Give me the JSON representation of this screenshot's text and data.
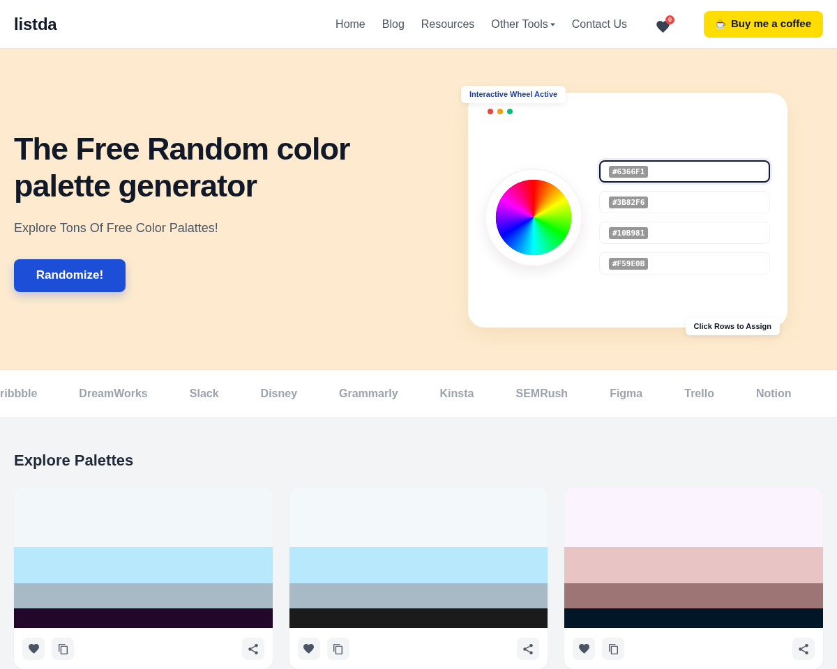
{
  "navbar": {
    "logo": "listda",
    "links": [
      {
        "label": "Home",
        "kind": "link"
      },
      {
        "label": "Blog",
        "kind": "link"
      },
      {
        "label": "Resources",
        "kind": "link"
      },
      {
        "label": "Other Tools",
        "kind": "dropdown"
      },
      {
        "label": "Contact Us",
        "kind": "link"
      }
    ],
    "favorites_count": "0",
    "coffee_button": "Buy me a coffee"
  },
  "hero": {
    "title": "The Free Random color palette generator",
    "subtitle": "Explore Tons Of Free Color Palattes!",
    "button": "Randomize!",
    "preview": {
      "badge": "Interactive Wheel Active",
      "window_dots": [
        {
          "color": "#ef4444"
        },
        {
          "color": "#f59e0b"
        },
        {
          "color": "#10b981"
        }
      ],
      "rows": [
        {
          "value": "#6366F1",
          "selected": true
        },
        {
          "value": "#3B82F6",
          "selected": false
        },
        {
          "value": "#10B981",
          "selected": false
        },
        {
          "value": "#F59E0B",
          "selected": false
        }
      ],
      "hint": "Click Rows to Assign"
    }
  },
  "brands": [
    "ribbble",
    "DreamWorks",
    "Slack",
    "Disney",
    "Grammarly",
    "Kinsta",
    "SEMRush",
    "Figma",
    "Trello",
    "Notion"
  ],
  "explore": {
    "title": "Explore Palettes",
    "palettes": [
      {
        "colors": [
          {
            "color": "#f2f7fa"
          },
          {
            "color": "#b8e8fb"
          },
          {
            "color": "#a7bac6"
          },
          {
            "color": "#22072a"
          }
        ]
      },
      {
        "colors": [
          {
            "color": "#f3f8fa"
          },
          {
            "color": "#b8e8fb"
          },
          {
            "color": "#a7bac6"
          },
          {
            "color": "#1b1b1b"
          }
        ]
      },
      {
        "colors": [
          {
            "color": "#fbf3fd"
          },
          {
            "color": "#e8c5c4"
          },
          {
            "color": "#9d7574"
          },
          {
            "color": "#011627"
          }
        ]
      }
    ]
  }
}
